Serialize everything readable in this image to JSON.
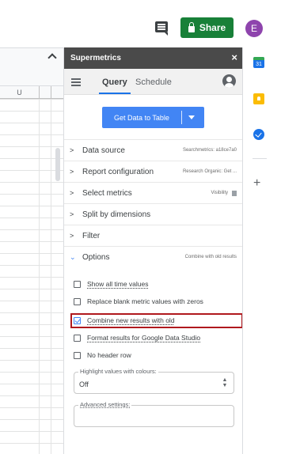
{
  "topbar": {
    "share_label": "Share",
    "avatar_letter": "E"
  },
  "sheet": {
    "column_label": "U"
  },
  "panel": {
    "title": "Supermetrics",
    "close_symbol": "×",
    "tabs": {
      "query": "Query",
      "schedule": "Schedule"
    },
    "get_data_button": "Get Data to Table",
    "sections": [
      {
        "label": "Data source",
        "summary": "Searchmetrics: a18ce7a0"
      },
      {
        "label": "Report configuration",
        "summary": "Research Organic: Get ..."
      },
      {
        "label": "Select metrics",
        "summary": "Visibility"
      },
      {
        "label": "Split by dimensions",
        "summary": ""
      },
      {
        "label": "Filter",
        "summary": ""
      },
      {
        "label": "Options",
        "summary": "Combine with old results"
      }
    ],
    "options": [
      {
        "label": "Show all time values",
        "checked": false
      },
      {
        "label": "Replace blank metric values with zeros",
        "checked": false
      },
      {
        "label": "Combine new results with old",
        "checked": true
      },
      {
        "label": "Format results for Google Data Studio",
        "checked": false
      },
      {
        "label": "No header row",
        "checked": false
      }
    ],
    "highlight_field": {
      "legend": "Highlight values with colours:",
      "value": "Off"
    },
    "advanced_field": {
      "legend": "Advanced settings:",
      "value": ""
    }
  },
  "rail": {
    "calendar_day": "31",
    "plus_symbol": "+"
  },
  "colors": {
    "share_green": "#188038",
    "avatar_purple": "#8e44ad",
    "primary_blue": "#4285f4",
    "highlight_red": "#b0191e",
    "panel_header": "#4a4a4a"
  }
}
